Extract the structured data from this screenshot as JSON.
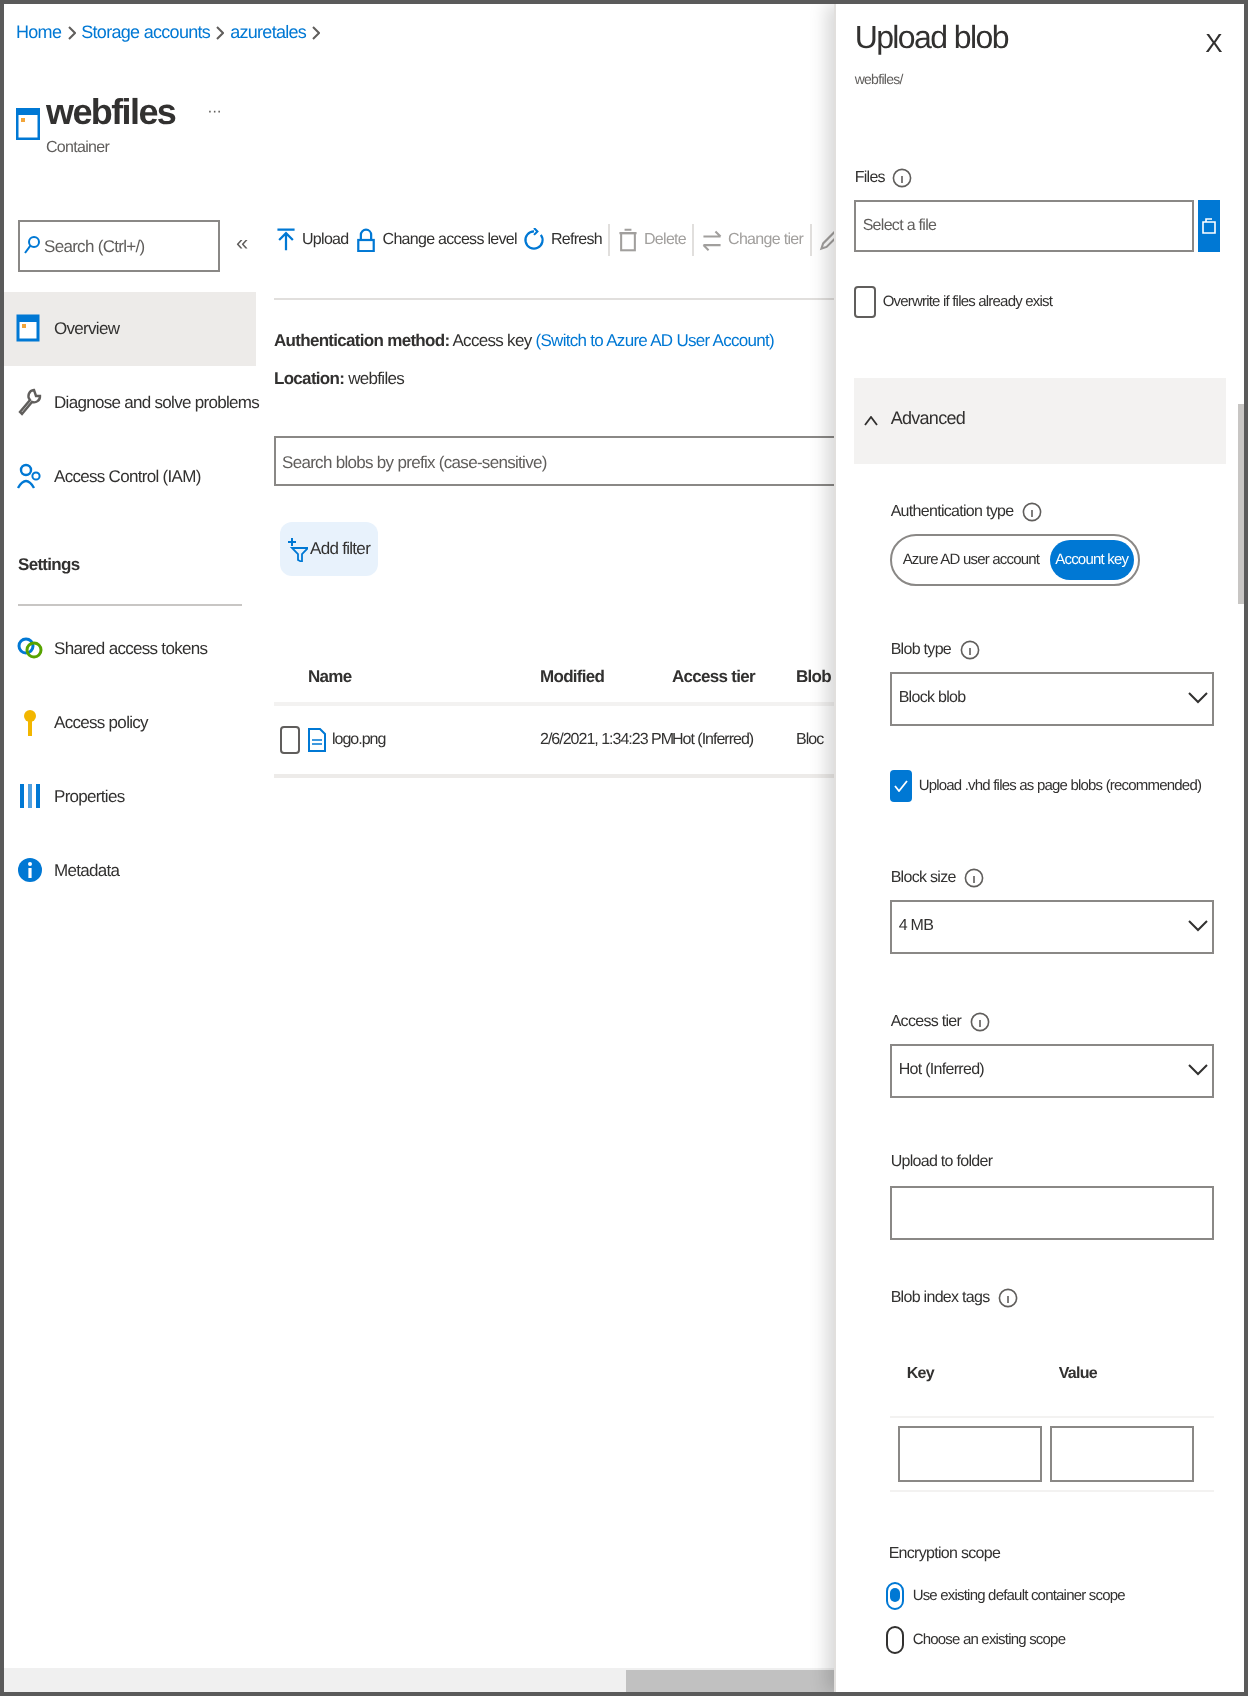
{
  "breadcrumb": [
    {
      "label": "Home"
    },
    {
      "label": "Storage accounts"
    },
    {
      "label": "azuretales"
    }
  ],
  "header": {
    "title": "webfiles",
    "more": "···",
    "subtitle": "Container"
  },
  "sidebar": {
    "search_placeholder": "Search (Ctrl+/)",
    "collapse": "«",
    "items": [
      {
        "label": "Overview",
        "selected": true
      },
      {
        "label": "Diagnose and solve problems",
        "selected": false
      },
      {
        "label": "Access Control (IAM)",
        "selected": false
      },
      {
        "kind": "section",
        "label": "Settings"
      },
      {
        "label": "Shared access tokens",
        "selected": false
      },
      {
        "label": "Access policy",
        "selected": false
      },
      {
        "label": "Properties",
        "selected": false
      },
      {
        "label": "Metadata",
        "selected": false
      }
    ]
  },
  "toolbar": [
    {
      "label": "Upload",
      "disabled": false
    },
    {
      "label": "Change access level",
      "disabled": false
    },
    {
      "label": "Refresh",
      "disabled": false
    },
    {
      "label": "Delete",
      "disabled": true
    },
    {
      "label": "Change tier",
      "disabled": true
    },
    {
      "disabled": true
    }
  ],
  "info": {
    "auth_label": "Authentication method:",
    "auth_value": "Access key",
    "auth_link": "(Switch to Azure AD User Account)",
    "location_label": "Location:",
    "location_value": "webfiles"
  },
  "blob_search": {
    "placeholder": "Search blobs by prefix (case-sensitive)"
  },
  "add_filter": "Add filter",
  "table": {
    "columns": [
      "Name",
      "Modified",
      "Access tier",
      "Blob"
    ],
    "rows": [
      {
        "checked": false,
        "cells": [
          "logo.png",
          "2/6/2021, 1:34:23 PM",
          "Hot (Inferred)",
          "Bloc"
        ]
      }
    ]
  },
  "panel": {
    "title": "Upload blob",
    "subtitle": "webfiles/",
    "close": "X",
    "files": {
      "label": "Files",
      "placeholder": "Select a file"
    },
    "overwrite": {
      "label": "Overwrite if files already exist",
      "checked": false
    },
    "advanced": {
      "label": "Advanced",
      "expanded": true
    },
    "auth_type": {
      "label": "Authentication type",
      "options": [
        {
          "label": "Azure AD user account",
          "selected": false
        },
        {
          "label": "Account key",
          "selected": true
        }
      ]
    },
    "blob_type": {
      "label": "Blob type",
      "value": "Block blob"
    },
    "vhd": {
      "label": "Upload .vhd files as page blobs (recommended)",
      "checked": true
    },
    "block_size": {
      "label": "Block size",
      "value": "4 MB"
    },
    "access_tier": {
      "label": "Access tier",
      "value": "Hot (Inferred)"
    },
    "upload_folder": {
      "label": "Upload to folder"
    },
    "tags": {
      "label": "Blob index tags",
      "columns": [
        "Key",
        "Value"
      ]
    },
    "encryption": {
      "label": "Encryption scope",
      "options": [
        {
          "label": "Use existing default container scope",
          "selected": true
        },
        {
          "label": "Choose an existing scope",
          "selected": false
        }
      ]
    }
  }
}
